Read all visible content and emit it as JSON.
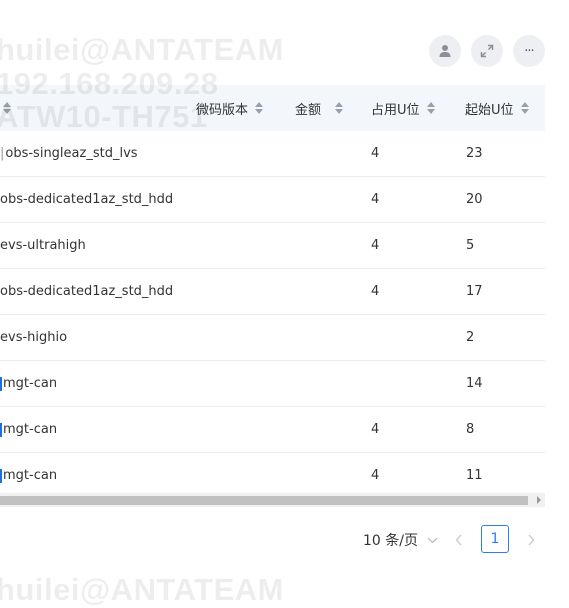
{
  "watermark": {
    "line1": "huilei@ANTATEAM",
    "line2": "192.168.209.28",
    "line3": "ATW10-TH751",
    "line4": "huilei@ANTATEAM"
  },
  "toolbar": {
    "user_icon": "user-icon",
    "expand_icon": "expand-icon",
    "more_label": "···"
  },
  "table": {
    "columns": {
      "firmware": "微码版本",
      "amount": "金额",
      "u_occupied": "占用U位",
      "start_u": "起始U位"
    },
    "rows": [
      {
        "name": "obs-singleaz_std_lvs",
        "marker": true,
        "marker_style": "pipe-gray",
        "u": "4",
        "start": "23"
      },
      {
        "name": "obs-dedicated1az_std_hdd",
        "marker": false,
        "u": "4",
        "start": "20"
      },
      {
        "name": "evs-ultrahigh",
        "marker": false,
        "u": "4",
        "start": "5"
      },
      {
        "name": "obs-dedicated1az_std_hdd",
        "marker": false,
        "u": "4",
        "start": "17"
      },
      {
        "name": "evs-highio",
        "marker": false,
        "u": "",
        "start": "2"
      },
      {
        "name": "mgt-can",
        "marker": true,
        "u": "",
        "start": "14"
      },
      {
        "name": "mgt-can",
        "marker": true,
        "u": "4",
        "start": "8"
      },
      {
        "name": "mgt-can",
        "marker": true,
        "u": "4",
        "start": "11"
      }
    ]
  },
  "pagination": {
    "page_size": "10 条/页",
    "current_page": "1"
  },
  "colors": {
    "accent": "#2f7bf0",
    "header_bg": "#f3f6fa"
  }
}
